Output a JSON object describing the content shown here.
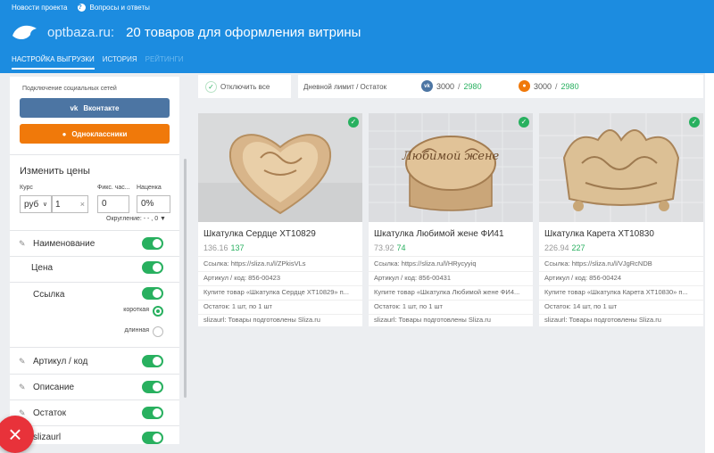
{
  "topbar": {
    "link_news": "Новости проекта",
    "link_faq": "Вопросы и ответы",
    "brand": "optbaza.ru:",
    "title": "20 товаров для оформления витрины",
    "tabs": [
      {
        "label": "НАСТРОЙКА ВЫГРУЗКИ",
        "state": "active"
      },
      {
        "label": "ИСТОРИЯ",
        "state": "normal"
      },
      {
        "label": "РЕЙТИНГИ",
        "state": "disabled"
      }
    ]
  },
  "sidebar": {
    "social_title": "Подключение социальных сетей",
    "vk_button": "Вконтакте",
    "ok_button": "Одноклассники",
    "prices_title": "Изменить цены",
    "rate_label": "Курс",
    "fixed_label": "Фикс. час...",
    "markup_label": "Наценка",
    "currency": "руб",
    "rate_value": "1",
    "fixed_value": "0",
    "markup_value": "0%",
    "rounding": "Округление: - - , 0 ▼",
    "fields": {
      "name": "Наименование",
      "price": "Цена",
      "link": "Ссылка",
      "link_short": "короткая",
      "link_long": "длинная",
      "sku": "Артикул / код",
      "description": "Описание",
      "stock": "Остаток",
      "slizaurl": "slizaurl"
    }
  },
  "header": {
    "disable_all": "Отключить все",
    "daily_limit": "Дневной лимит / Остаток",
    "vk_limit": "3000",
    "vk_left": "2980",
    "ok_limit": "3000",
    "ok_left": "2980"
  },
  "colors": {
    "brand_blue": "#1c8ce0",
    "green": "#28b05f",
    "vk": "#4c75a3",
    "ok": "#f0790a",
    "fab_red": "#e8323a"
  },
  "products": [
    {
      "title": "Шкатулка Сердце ХТ10829",
      "old_price": "136.16",
      "new_price": "137",
      "link": "Ссылка: https://sliza.ru/l/ZPkisVLs",
      "sku": "Артикул / код: 856-00423",
      "desc": "Купите товар «Шкатулка Сердце ХТ10829» п...",
      "stock": "Остаток: 1 шт, по 1 шт",
      "footer": "slizaurl: Товары подготовлены Sliza.ru"
    },
    {
      "title": "Шкатулка Любимой жене ФИ41",
      "old_price": "73.92",
      "new_price": "74",
      "link": "Ссылка: https://sliza.ru/l/HRycyyiq",
      "sku": "Артикул / код: 856-00431",
      "desc": "Купите товар «Шкатулка Любимой жене ФИ4...",
      "stock": "Остаток: 1 шт, по 1 шт",
      "footer": "slizaurl: Товары подготовлены Sliza.ru",
      "box_text": "Любимой жене"
    },
    {
      "title": "Шкатулка Карета ХТ10830",
      "old_price": "226.94",
      "new_price": "227",
      "link": "Ссылка: https://sliza.ru/l/VJgRcNDB",
      "sku": "Артикул / код: 856-00424",
      "desc": "Купите товар «Шкатулка Карета ХТ10830» п...",
      "stock": "Остаток: 14 шт, по 1 шт",
      "footer": "slizaurl: Товары подготовлены Sliza.ru"
    }
  ]
}
